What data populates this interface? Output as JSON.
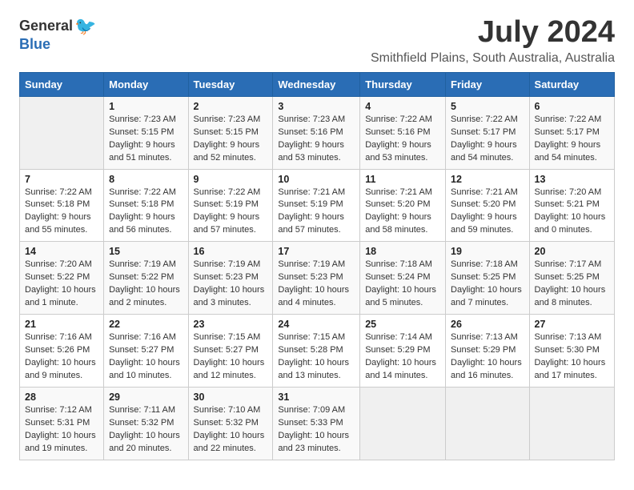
{
  "logo": {
    "general": "General",
    "blue": "Blue"
  },
  "title": "July 2024",
  "subtitle": "Smithfield Plains, South Australia, Australia",
  "header": {
    "days": [
      "Sunday",
      "Monday",
      "Tuesday",
      "Wednesday",
      "Thursday",
      "Friday",
      "Saturday"
    ]
  },
  "weeks": [
    [
      {
        "day": "",
        "info": ""
      },
      {
        "day": "1",
        "info": "Sunrise: 7:23 AM\nSunset: 5:15 PM\nDaylight: 9 hours\nand 51 minutes."
      },
      {
        "day": "2",
        "info": "Sunrise: 7:23 AM\nSunset: 5:15 PM\nDaylight: 9 hours\nand 52 minutes."
      },
      {
        "day": "3",
        "info": "Sunrise: 7:23 AM\nSunset: 5:16 PM\nDaylight: 9 hours\nand 53 minutes."
      },
      {
        "day": "4",
        "info": "Sunrise: 7:22 AM\nSunset: 5:16 PM\nDaylight: 9 hours\nand 53 minutes."
      },
      {
        "day": "5",
        "info": "Sunrise: 7:22 AM\nSunset: 5:17 PM\nDaylight: 9 hours\nand 54 minutes."
      },
      {
        "day": "6",
        "info": "Sunrise: 7:22 AM\nSunset: 5:17 PM\nDaylight: 9 hours\nand 54 minutes."
      }
    ],
    [
      {
        "day": "7",
        "info": "Sunrise: 7:22 AM\nSunset: 5:18 PM\nDaylight: 9 hours\nand 55 minutes."
      },
      {
        "day": "8",
        "info": "Sunrise: 7:22 AM\nSunset: 5:18 PM\nDaylight: 9 hours\nand 56 minutes."
      },
      {
        "day": "9",
        "info": "Sunrise: 7:22 AM\nSunset: 5:19 PM\nDaylight: 9 hours\nand 57 minutes."
      },
      {
        "day": "10",
        "info": "Sunrise: 7:21 AM\nSunset: 5:19 PM\nDaylight: 9 hours\nand 57 minutes."
      },
      {
        "day": "11",
        "info": "Sunrise: 7:21 AM\nSunset: 5:20 PM\nDaylight: 9 hours\nand 58 minutes."
      },
      {
        "day": "12",
        "info": "Sunrise: 7:21 AM\nSunset: 5:20 PM\nDaylight: 9 hours\nand 59 minutes."
      },
      {
        "day": "13",
        "info": "Sunrise: 7:20 AM\nSunset: 5:21 PM\nDaylight: 10 hours\nand 0 minutes."
      }
    ],
    [
      {
        "day": "14",
        "info": "Sunrise: 7:20 AM\nSunset: 5:22 PM\nDaylight: 10 hours\nand 1 minute."
      },
      {
        "day": "15",
        "info": "Sunrise: 7:19 AM\nSunset: 5:22 PM\nDaylight: 10 hours\nand 2 minutes."
      },
      {
        "day": "16",
        "info": "Sunrise: 7:19 AM\nSunset: 5:23 PM\nDaylight: 10 hours\nand 3 minutes."
      },
      {
        "day": "17",
        "info": "Sunrise: 7:19 AM\nSunset: 5:23 PM\nDaylight: 10 hours\nand 4 minutes."
      },
      {
        "day": "18",
        "info": "Sunrise: 7:18 AM\nSunset: 5:24 PM\nDaylight: 10 hours\nand 5 minutes."
      },
      {
        "day": "19",
        "info": "Sunrise: 7:18 AM\nSunset: 5:25 PM\nDaylight: 10 hours\nand 7 minutes."
      },
      {
        "day": "20",
        "info": "Sunrise: 7:17 AM\nSunset: 5:25 PM\nDaylight: 10 hours\nand 8 minutes."
      }
    ],
    [
      {
        "day": "21",
        "info": "Sunrise: 7:16 AM\nSunset: 5:26 PM\nDaylight: 10 hours\nand 9 minutes."
      },
      {
        "day": "22",
        "info": "Sunrise: 7:16 AM\nSunset: 5:27 PM\nDaylight: 10 hours\nand 10 minutes."
      },
      {
        "day": "23",
        "info": "Sunrise: 7:15 AM\nSunset: 5:27 PM\nDaylight: 10 hours\nand 12 minutes."
      },
      {
        "day": "24",
        "info": "Sunrise: 7:15 AM\nSunset: 5:28 PM\nDaylight: 10 hours\nand 13 minutes."
      },
      {
        "day": "25",
        "info": "Sunrise: 7:14 AM\nSunset: 5:29 PM\nDaylight: 10 hours\nand 14 minutes."
      },
      {
        "day": "26",
        "info": "Sunrise: 7:13 AM\nSunset: 5:29 PM\nDaylight: 10 hours\nand 16 minutes."
      },
      {
        "day": "27",
        "info": "Sunrise: 7:13 AM\nSunset: 5:30 PM\nDaylight: 10 hours\nand 17 minutes."
      }
    ],
    [
      {
        "day": "28",
        "info": "Sunrise: 7:12 AM\nSunset: 5:31 PM\nDaylight: 10 hours\nand 19 minutes."
      },
      {
        "day": "29",
        "info": "Sunrise: 7:11 AM\nSunset: 5:32 PM\nDaylight: 10 hours\nand 20 minutes."
      },
      {
        "day": "30",
        "info": "Sunrise: 7:10 AM\nSunset: 5:32 PM\nDaylight: 10 hours\nand 22 minutes."
      },
      {
        "day": "31",
        "info": "Sunrise: 7:09 AM\nSunset: 5:33 PM\nDaylight: 10 hours\nand 23 minutes."
      },
      {
        "day": "",
        "info": ""
      },
      {
        "day": "",
        "info": ""
      },
      {
        "day": "",
        "info": ""
      }
    ]
  ]
}
